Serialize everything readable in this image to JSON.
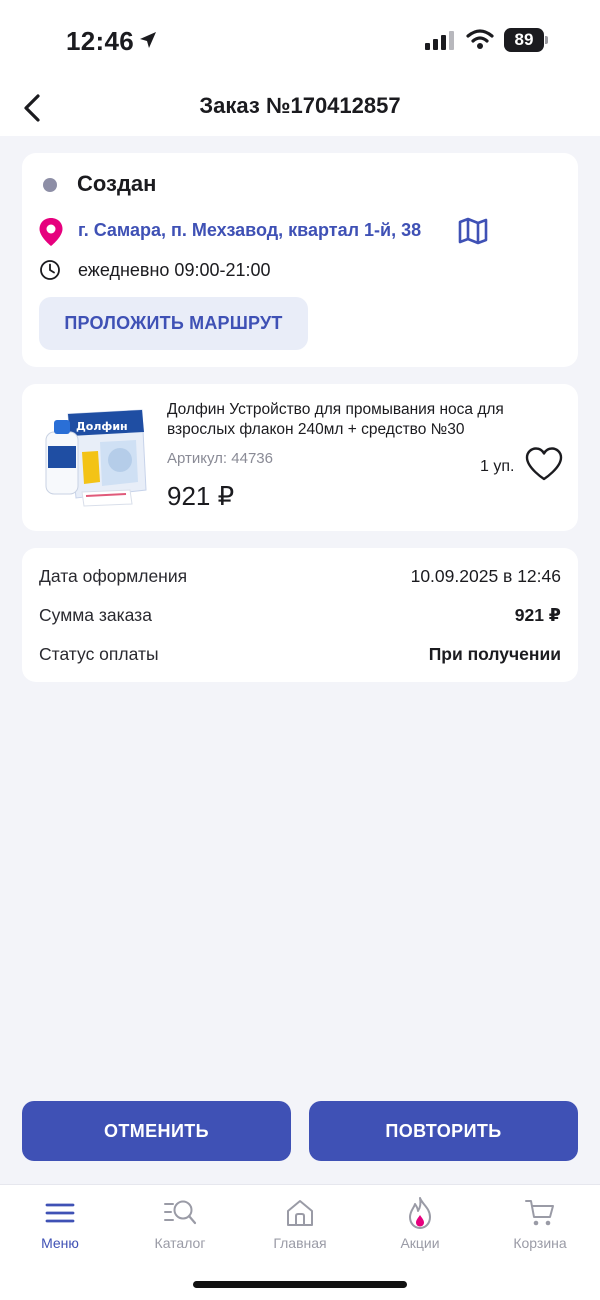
{
  "status_bar": {
    "time": "12:46",
    "battery": "89"
  },
  "header": {
    "title": "Заказ №170412857"
  },
  "order_status": {
    "status": "Создан",
    "address": "г. Самара, п. Мехзавод, квартал 1-й, 38",
    "hours": "ежедневно 09:00-21:00",
    "route_button": "ПРОЛОЖИТЬ МАРШРУТ"
  },
  "product": {
    "name": "Долфин Устройство для промывания носа для взрослых флакон 240мл + средство №30",
    "sku": "Артикул: 44736",
    "quantity": "1 уп.",
    "price": "921 ₽",
    "image_label": "Долфин"
  },
  "order_info": [
    {
      "label": "Дата оформления",
      "value": "10.09.2025 в 12:46"
    },
    {
      "label": "Сумма заказа",
      "value": "921 ₽"
    },
    {
      "label": "Статус оплаты",
      "value": "При получении"
    }
  ],
  "actions": {
    "cancel": "ОТМЕНИТЬ",
    "repeat": "ПОВТОРИТЬ"
  },
  "tabs": [
    {
      "label": "Меню",
      "icon": "menu-icon",
      "active": true
    },
    {
      "label": "Каталог",
      "icon": "catalog-search-icon",
      "active": false
    },
    {
      "label": "Главная",
      "icon": "home-icon",
      "active": false
    },
    {
      "label": "Акции",
      "icon": "flame-icon",
      "active": false
    },
    {
      "label": "Корзина",
      "icon": "cart-icon",
      "active": false
    }
  ],
  "colors": {
    "accent": "#3f51b5",
    "pin": "#e6007e",
    "background": "#f3f4f9",
    "status_dot": "#8d8ea6"
  }
}
